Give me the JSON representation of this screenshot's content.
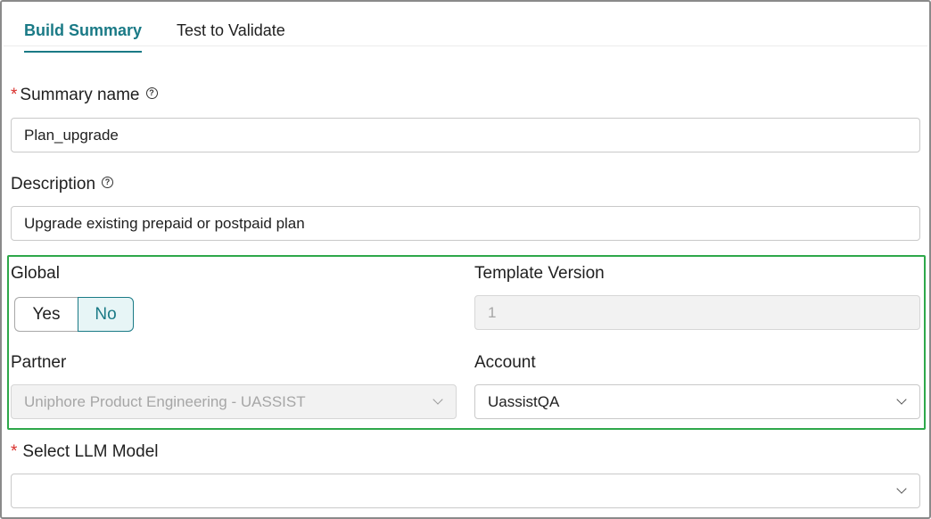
{
  "tabs": [
    {
      "label": "Build Summary",
      "active": true
    },
    {
      "label": "Test to Validate",
      "active": false
    }
  ],
  "form": {
    "summary_name": {
      "label": "Summary name",
      "required": true,
      "value": "Plan_upgrade"
    },
    "description": {
      "label": "Description",
      "required": false,
      "value": "Upgrade existing prepaid or postpaid plan"
    },
    "global": {
      "label": "Global",
      "options": [
        "Yes",
        "No"
      ],
      "selected": "No"
    },
    "template_version": {
      "label": "Template Version",
      "value": "1",
      "disabled": true
    },
    "partner": {
      "label": "Partner",
      "value": "Uniphore Product Engineering - UASSIST",
      "disabled": true
    },
    "account": {
      "label": "Account",
      "value": "UassistQA"
    },
    "llm_model": {
      "label": "Select LLM Model",
      "required": true,
      "value": ""
    }
  },
  "required_mark": "*",
  "help_glyph": "?",
  "colors": {
    "accent": "#1a7a86",
    "required": "#d9302c",
    "highlight": "#2ea84a"
  }
}
